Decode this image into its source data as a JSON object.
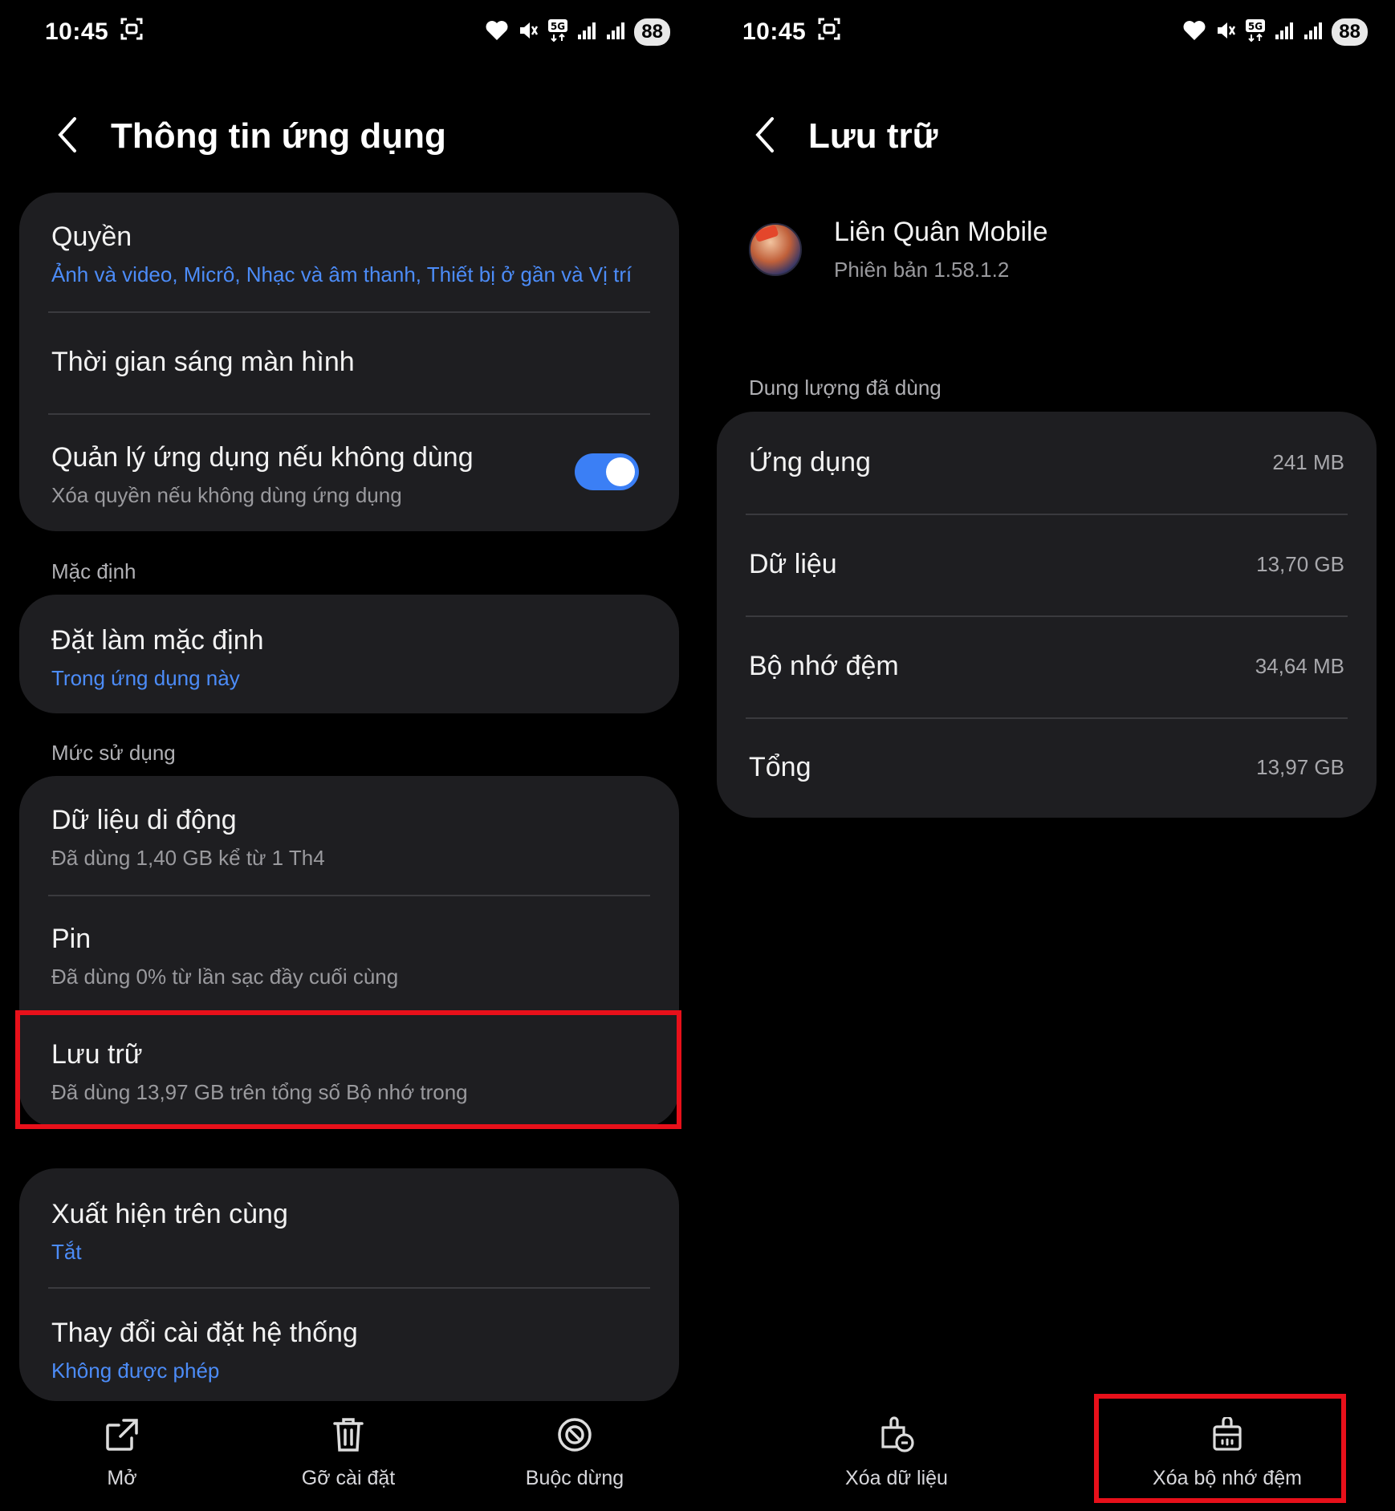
{
  "status_bar": {
    "time": "10:45",
    "battery": "88"
  },
  "left": {
    "title": "Thông tin ứng dụng",
    "card1": {
      "permissions": {
        "title": "Quyền",
        "sub": "Ảnh và video, Micrô, Nhạc và âm thanh, Thiết bị ở gần và Vị trí"
      },
      "screen_time": {
        "title": "Thời gian sáng màn hình"
      },
      "manage_unused": {
        "title": "Quản lý ứng dụng nếu không dùng",
        "sub": "Xóa quyền nếu không dùng ứng dụng",
        "toggle_on": true
      }
    },
    "section_default": "Mặc định",
    "card2": {
      "set_default": {
        "title": "Đặt làm mặc định",
        "sub": "Trong ứng dụng này"
      }
    },
    "section_usage": "Mức sử dụng",
    "card3": {
      "mobile_data": {
        "title": "Dữ liệu di động",
        "sub": "Đã dùng 1,40 GB kể từ 1 Th4"
      },
      "battery": {
        "title": "Pin",
        "sub": "Đã dùng 0% từ lần sạc đầy cuối cùng"
      },
      "storage": {
        "title": "Lưu trữ",
        "sub": "Đã dùng 13,97 GB trên tổng số Bộ nhớ trong"
      }
    },
    "card4": {
      "appear_on_top": {
        "title": "Xuất hiện trên cùng",
        "sub": "Tắt"
      },
      "modify_system": {
        "title": "Thay đổi cài đặt hệ thống",
        "sub": "Không được phép"
      }
    },
    "bottom": {
      "open": "Mở",
      "uninstall": "Gỡ cài đặt",
      "force_stop": "Buộc dừng"
    }
  },
  "right": {
    "title": "Lưu trữ",
    "app": {
      "name": "Liên Quân Mobile",
      "version": "Phiên bản 1.58.1.2"
    },
    "section_used": "Dung lượng đã dùng",
    "rows": [
      {
        "label": "Ứng dụng",
        "value": "241 MB"
      },
      {
        "label": "Dữ liệu",
        "value": "13,70 GB"
      },
      {
        "label": "Bộ nhớ đệm",
        "value": "34,64 MB"
      },
      {
        "label": "Tổng",
        "value": "13,97 GB"
      }
    ],
    "bottom": {
      "clear_data": "Xóa dữ liệu",
      "clear_cache": "Xóa bộ nhớ đệm"
    }
  },
  "colors": {
    "accent": "#3b7ff5",
    "link": "#4c8cf8",
    "highlight": "#e8101a",
    "card": "#1e1e21"
  },
  "icons": [
    "screenshot-icon",
    "heart-icon",
    "mute-icon",
    "5g-icon",
    "signal-icon",
    "back-icon",
    "open-icon",
    "trash-icon",
    "stop-icon",
    "clear-data-icon",
    "clear-cache-icon"
  ]
}
